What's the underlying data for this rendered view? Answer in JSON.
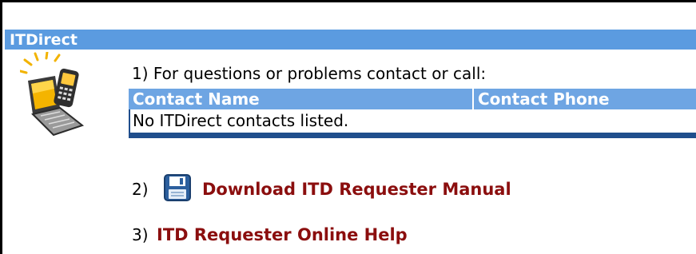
{
  "header": {
    "title": "ITDirect"
  },
  "section1": {
    "label": "1) For questions or problems contact or call:",
    "table": {
      "columns": [
        "Contact Name",
        "Contact Phone"
      ],
      "empty_message": "No ITDirect contacts listed."
    }
  },
  "section2": {
    "number": "2)",
    "icon": "floppy-disk-icon",
    "link": "Download ITD Requester Manual"
  },
  "section3": {
    "number": "3)",
    "link": "ITD Requester Online Help"
  },
  "colors": {
    "header_bar": "#5b9be0",
    "table_header": "#6ea5e3",
    "table_border": "#1f4e8c",
    "link": "#8b0e0e"
  }
}
